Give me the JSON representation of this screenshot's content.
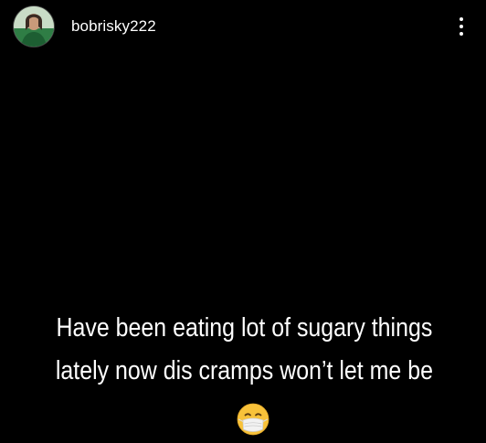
{
  "story": {
    "username": "bobrisky222",
    "caption_lines": [
      "Have been eating lot of sugary things",
      "lately now dis cramps won’t let me be"
    ],
    "emoji": "face-with-medical-mask"
  },
  "icons": {
    "avatar": "profile-photo",
    "menu": "more-vertical-icon"
  },
  "colors": {
    "background": "#000000",
    "text": "#ffffff",
    "emoji_face": "#f8c23a",
    "mask": "#f2f2f2"
  }
}
